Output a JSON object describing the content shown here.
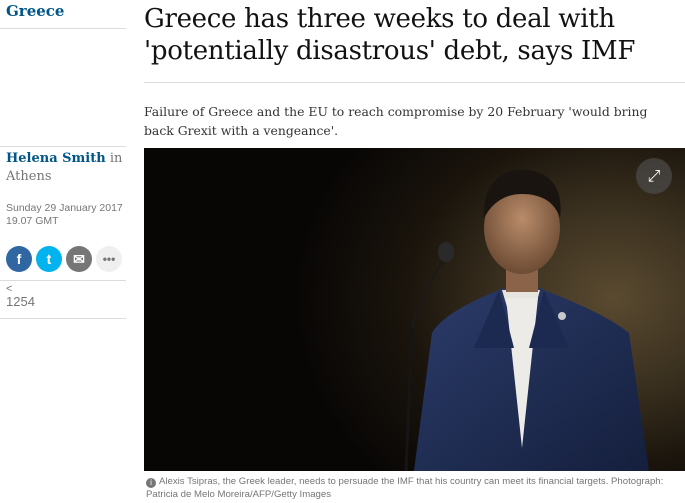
{
  "section": {
    "label": "Greece"
  },
  "headline": "Greece has three weeks to deal with 'potentially disastrous' debt, says IMF",
  "standfirst": "Failure of Greece and the EU to reach compromise by 20 February 'would bring back Grexit with a vengeance'.",
  "byline": {
    "author": "Helena Smith",
    "location_prefix": " in",
    "location": "Athens"
  },
  "dateline": {
    "date": "Sunday 29 January 2017",
    "time": "19.07 GMT"
  },
  "share": {
    "facebook_icon": "f",
    "twitter_icon": "t",
    "email_icon": "✉",
    "more_icon": "•••",
    "share_glyph": "<",
    "count": "1254"
  },
  "photo": {
    "alt": "Alexis Tsipras standing at a microphone",
    "expand_icon": "⤢"
  },
  "caption": {
    "icon": "i",
    "text": "Alexis Tsipras, the Greek leader, needs to persuade the IMF that his country can meet its financial targets. Photograph: Patricia de Melo Moreira/AFP/Getty Images"
  },
  "colors": {
    "brand_blue": "#005689",
    "facebook": "#3067a3",
    "twitter": "#03b3ee",
    "grey": "#767676"
  }
}
